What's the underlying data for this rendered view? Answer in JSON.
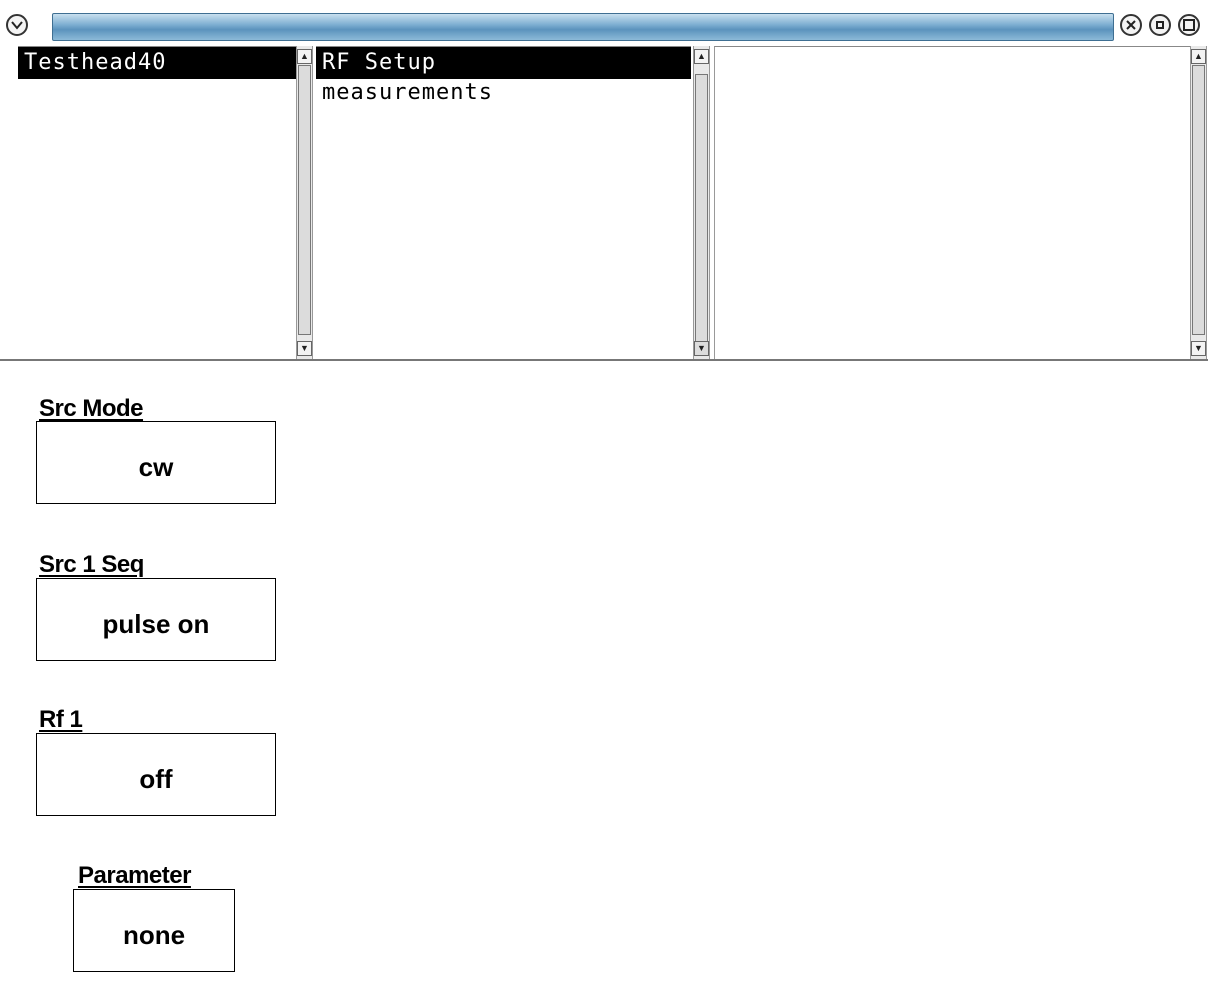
{
  "titlebar": {
    "menu_icon": "chevron-down-icon",
    "close_icon": "close-icon",
    "minimize_icon": "minimize-icon",
    "maximize_icon": "maximize-icon"
  },
  "panes": {
    "left": {
      "items": [
        {
          "label": "Testhead40",
          "selected": true
        }
      ]
    },
    "middle": {
      "items": [
        {
          "label": "RF Setup",
          "selected": true
        },
        {
          "label": "measurements",
          "selected": false
        }
      ]
    },
    "right": {
      "items": []
    }
  },
  "params": [
    {
      "label": "Src Mode",
      "value": "cw"
    },
    {
      "label": "Src 1 Seq",
      "value": "pulse on"
    },
    {
      "label": "Rf 1",
      "value": "off"
    },
    {
      "label": "Parameter",
      "value": "none"
    }
  ]
}
